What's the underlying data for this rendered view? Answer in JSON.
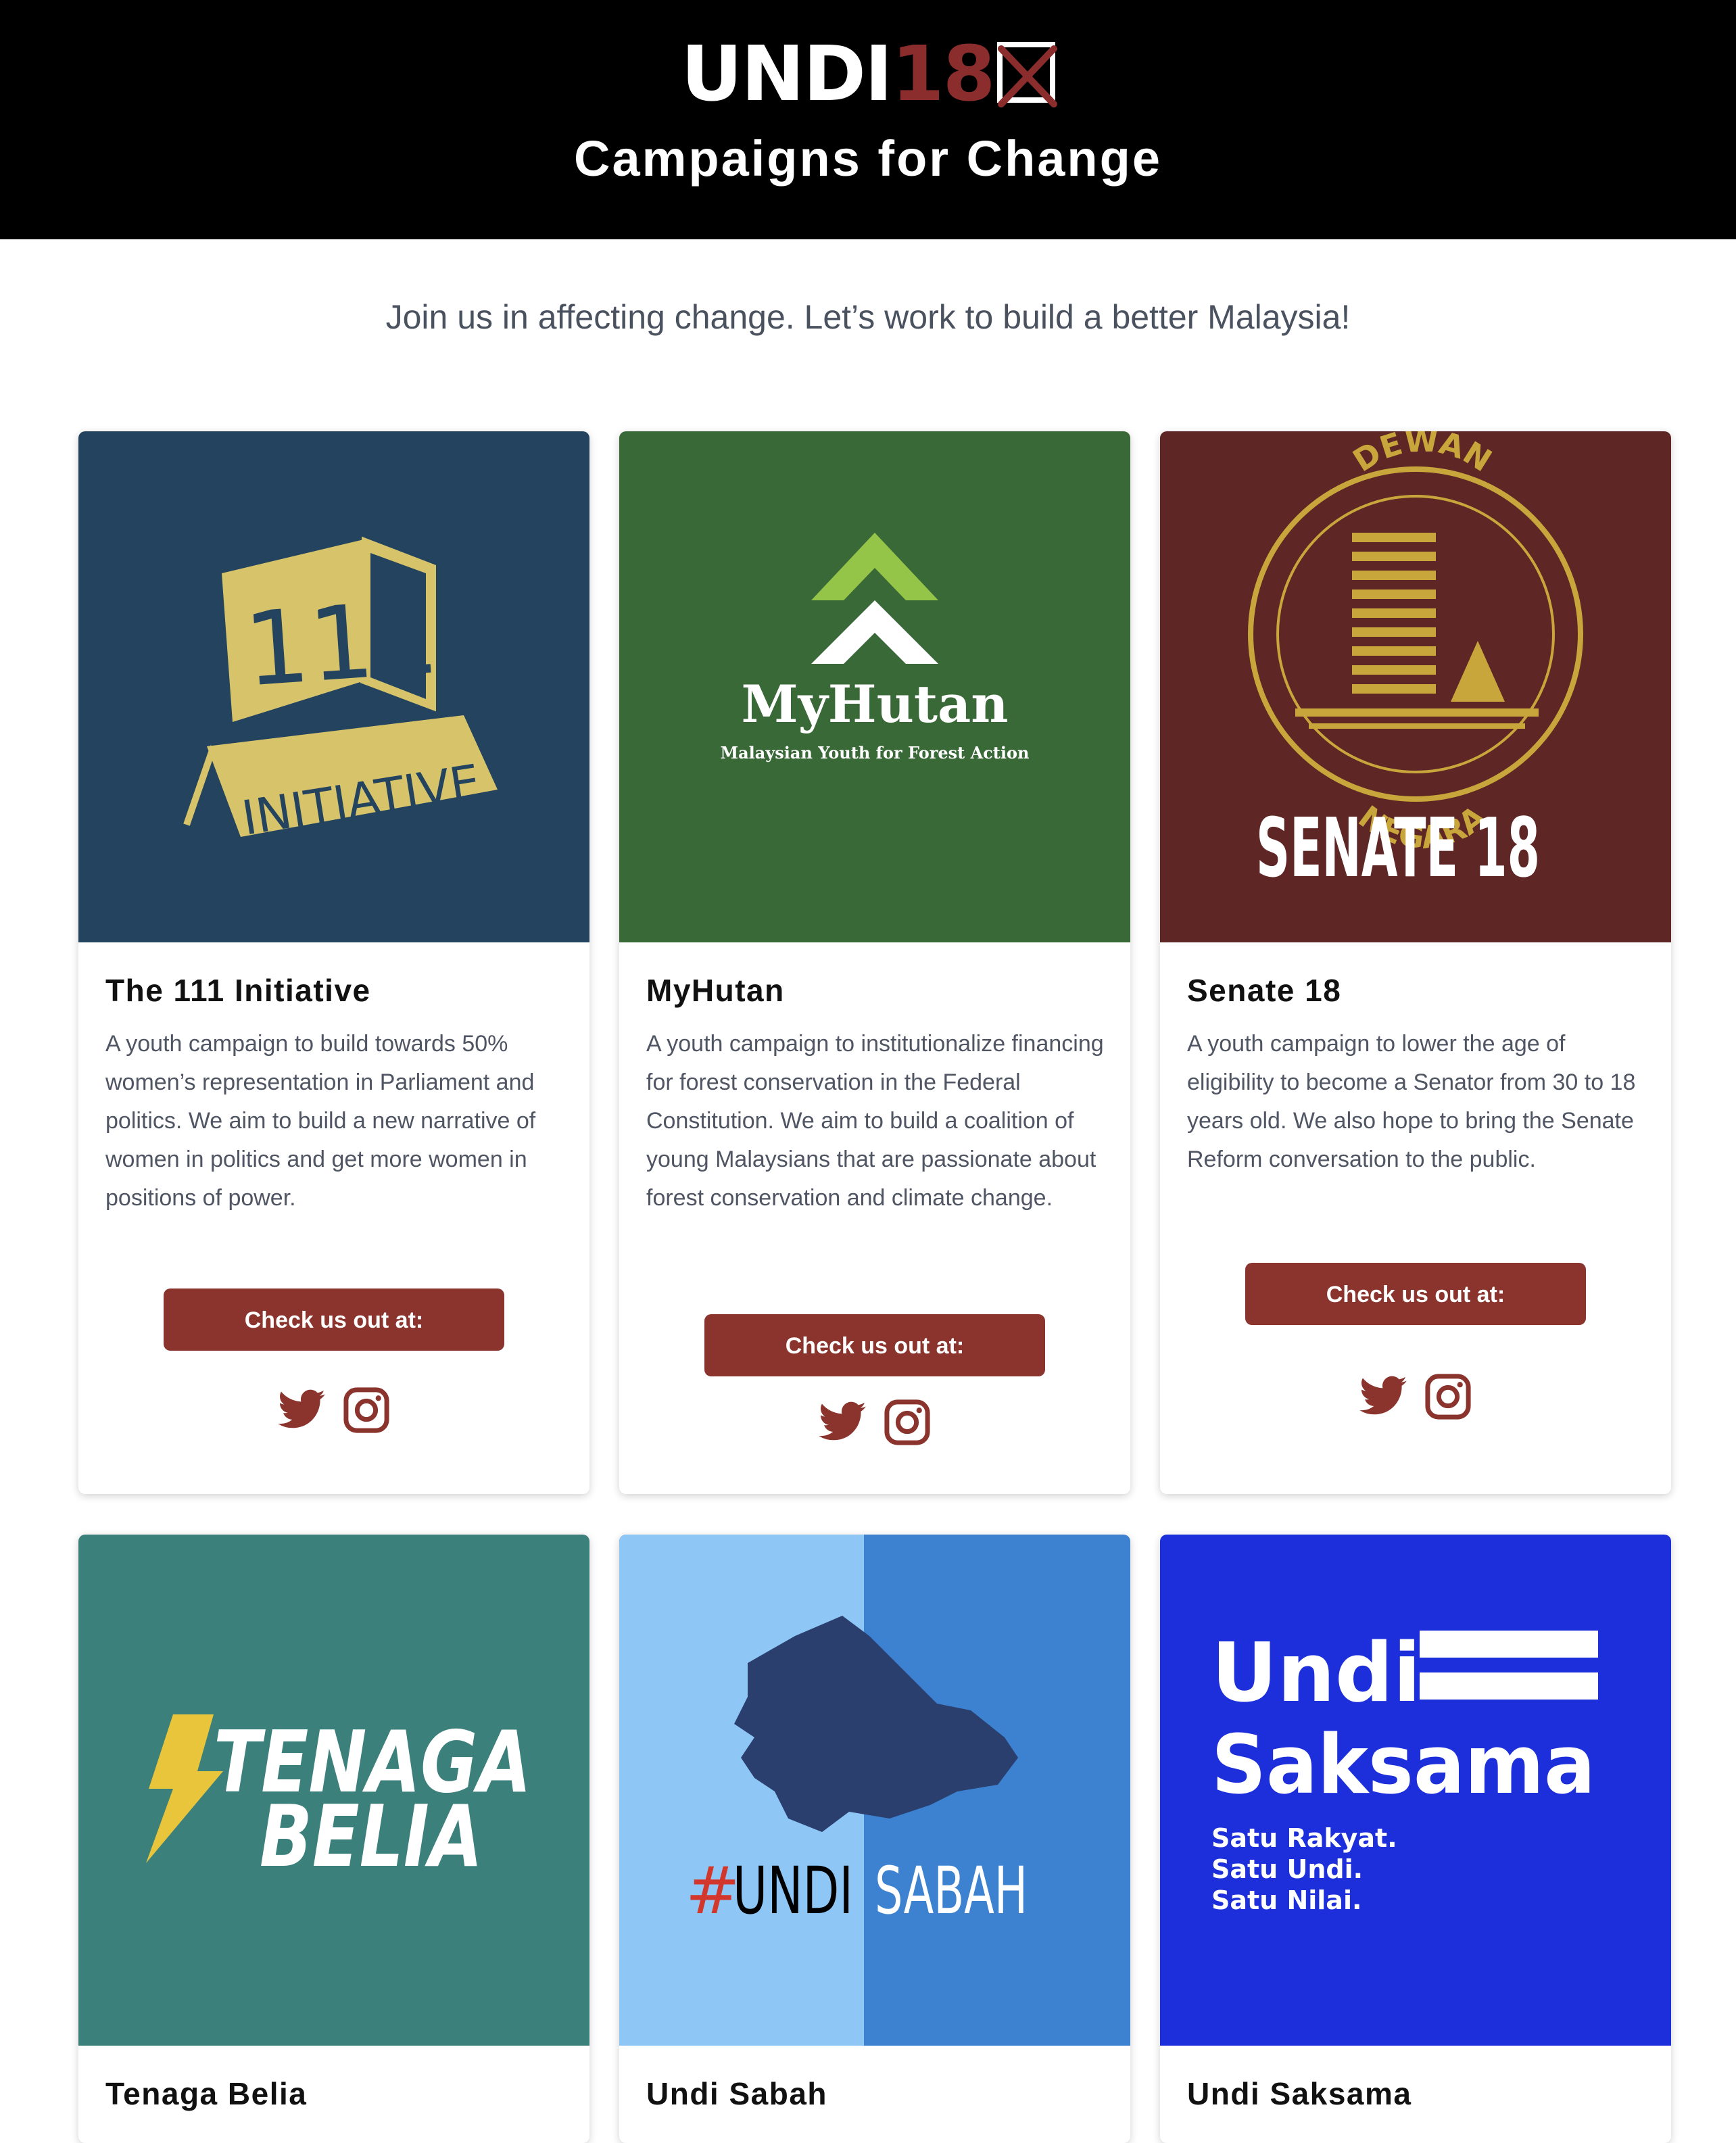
{
  "header": {
    "logo_text_white": "UNDI",
    "logo_text_red": "18",
    "title": "Campaigns for Change"
  },
  "subtitle": "Join us in affecting change. Let’s work to build a better Malaysia!",
  "cards": [
    {
      "title": "The 111 Initiative",
      "description": "A youth campaign to build towards 50% women’s representation in Parliament and politics. We aim to build a new narrative of women in politics and get more women in positions of power.",
      "button_label": "Check us out at:",
      "logo_text": [
        "111",
        "INITIATIVE"
      ],
      "bg_color": "#23435e"
    },
    {
      "title": "MyHutan",
      "description": "A youth campaign to institutionalize financing for forest conservation in the Federal Constitution. We aim to build a coalition of young Malaysians that are passionate about forest conservation and climate change.",
      "button_label": "Check us out at:",
      "logo_text": [
        "MyHutan",
        "Malaysian Youth for Forest Action"
      ],
      "bg_color": "#3a6938"
    },
    {
      "title": "Senate 18",
      "description": "A youth campaign to lower the age of eligibility to become a Senator from 30 to 18 years old. We also hope to bring the Senate Reform conversation to the public.",
      "button_label": "Check us out at:",
      "logo_text": [
        "DEWAN",
        "NEGARA",
        "SENATE 18"
      ],
      "bg_color": "#5e2625"
    },
    {
      "title": "Tenaga Belia",
      "logo_text": [
        "TENAGA",
        "BELIA"
      ],
      "bg_color": "#3c807c"
    },
    {
      "title": "Undi Sabah",
      "logo_text": [
        "#",
        "UNDI",
        "SABAH"
      ],
      "bg_color": "#3d82d0"
    },
    {
      "title": "Undi Saksama",
      "logo_text": [
        "Undi",
        "Saksama",
        "Satu Rakyat.",
        "Satu Undi.",
        "Satu Nilai."
      ],
      "bg_color": "#1c2fdb"
    }
  ],
  "colors": {
    "accent": "#8b342d",
    "header_bg": "#000000"
  },
  "icons": [
    "twitter-icon",
    "instagram-icon"
  ]
}
